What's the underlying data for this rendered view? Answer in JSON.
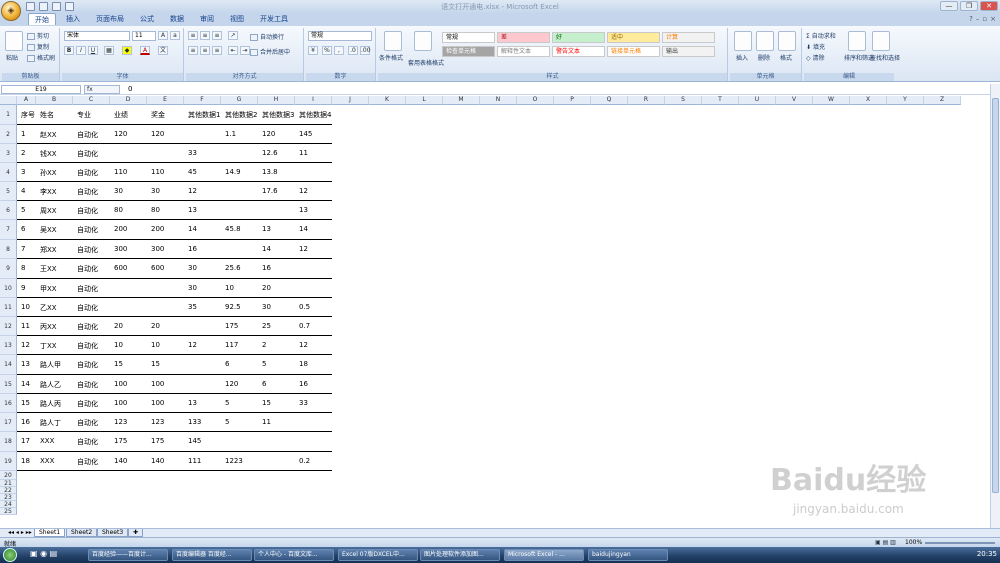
{
  "window": {
    "title": "语文打开通电.xlsx - Microsoft Excel",
    "min": "—",
    "max": "❐",
    "close": "✕"
  },
  "tabs": [
    "开始",
    "插入",
    "页面布局",
    "公式",
    "数据",
    "审阅",
    "视图",
    "开发工具"
  ],
  "ribbon": {
    "clipboard": {
      "label": "剪贴板",
      "paste": "粘贴",
      "cut": "剪切",
      "copy": "复制",
      "format_painter": "格式刷"
    },
    "font": {
      "label": "字体",
      "name": "宋体",
      "size": "11"
    },
    "alignment": {
      "label": "对齐方式",
      "wrap": "自动换行",
      "merge": "合并后居中"
    },
    "number": {
      "label": "数字",
      "format": "常规",
      "percent": "%",
      "comma": ","
    },
    "styles": {
      "label": "样式",
      "conditional": "条件格式",
      "table": "套用表格格式",
      "cells": [
        {
          "text": "常规",
          "bg": "#ffffff",
          "fg": "#000000"
        },
        {
          "text": "差",
          "bg": "#ffc7ce",
          "fg": "#9c0006"
        },
        {
          "text": "好",
          "bg": "#c6efce",
          "fg": "#006100"
        },
        {
          "text": "适中",
          "bg": "#ffeb9c",
          "fg": "#9c6500"
        },
        {
          "text": "计算",
          "bg": "#f2f2f2",
          "fg": "#fa7d00"
        },
        {
          "text": "检查单元格",
          "bg": "#a5a5a5",
          "fg": "#ffffff"
        },
        {
          "text": "解释性文本",
          "bg": "#ffffff",
          "fg": "#7f7f7f"
        },
        {
          "text": "警告文本",
          "bg": "#ffffff",
          "fg": "#ff0000"
        },
        {
          "text": "链接单元格",
          "bg": "#ffffff",
          "fg": "#fa7d00"
        },
        {
          "text": "输出",
          "bg": "#f2f2f2",
          "fg": "#3f3f3f"
        }
      ]
    },
    "cells_group": {
      "label": "单元格",
      "insert": "插入",
      "delete": "删除",
      "format": "格式"
    },
    "editing": {
      "label": "编辑",
      "autosum": "自动求和",
      "fill": "填充",
      "clear": "清除",
      "sort": "排序和筛选",
      "find": "查找和选择"
    }
  },
  "formula_bar": {
    "name_box": "E19",
    "fx": "fx",
    "value": "0"
  },
  "columns": [
    "A",
    "B",
    "C",
    "D",
    "E",
    "F",
    "G",
    "H",
    "I",
    "J",
    "K",
    "L",
    "M",
    "N",
    "O",
    "P",
    "Q",
    "R",
    "S",
    "T",
    "U",
    "V",
    "W",
    "X",
    "Y",
    "Z"
  ],
  "table": {
    "headers": [
      "序号",
      "姓名",
      "专业",
      "业绩",
      "奖金",
      "其他数据1",
      "其他数据2",
      "其他数据3",
      "其他数据4"
    ],
    "rows": [
      [
        "1",
        "赵XX",
        "自动化",
        "120",
        "120",
        "",
        "1.1",
        "120",
        "145"
      ],
      [
        "2",
        "钱XX",
        "自动化",
        "",
        "",
        "33",
        "",
        "12.6",
        "11"
      ],
      [
        "3",
        "孙XX",
        "自动化",
        "110",
        "110",
        "45",
        "14.9",
        "13.8",
        ""
      ],
      [
        "4",
        "李XX",
        "自动化",
        "30",
        "30",
        "12",
        "",
        "17.6",
        "12"
      ],
      [
        "5",
        "周XX",
        "自动化",
        "80",
        "80",
        "13",
        "",
        "",
        "13"
      ],
      [
        "6",
        "吴XX",
        "自动化",
        "200",
        "200",
        "14",
        "45.8",
        "13",
        "14"
      ],
      [
        "7",
        "郑XX",
        "自动化",
        "300",
        "300",
        "16",
        "",
        "14",
        "12"
      ],
      [
        "8",
        "王XX",
        "自动化",
        "600",
        "600",
        "30",
        "25.6",
        "16",
        ""
      ],
      [
        "9",
        "甲XX",
        "自动化",
        "",
        "",
        "30",
        "10",
        "20",
        ""
      ],
      [
        "10",
        "乙XX",
        "自动化",
        "",
        "",
        "35",
        "92.5",
        "30",
        "0.5"
      ],
      [
        "11",
        "丙XX",
        "自动化",
        "20",
        "20",
        "",
        "175",
        "25",
        "0.7"
      ],
      [
        "12",
        "丁XX",
        "自动化",
        "10",
        "10",
        "12",
        "117",
        "2",
        "12"
      ],
      [
        "13",
        "路人甲",
        "自动化",
        "15",
        "15",
        "",
        "6",
        "5",
        "18"
      ],
      [
        "14",
        "路人乙",
        "自动化",
        "100",
        "100",
        "",
        "120",
        "6",
        "16"
      ],
      [
        "15",
        "路人丙",
        "自动化",
        "100",
        "100",
        "13",
        "5",
        "15",
        "33"
      ],
      [
        "16",
        "路人丁",
        "自动化",
        "123",
        "123",
        "133",
        "5",
        "11",
        ""
      ],
      [
        "17",
        "XXX",
        "自动化",
        "175",
        "175",
        "145",
        "",
        "",
        ""
      ],
      [
        "18",
        "XXX",
        "自动化",
        "140",
        "140",
        "111",
        "1223",
        "",
        "0.2"
      ]
    ]
  },
  "row_numbers": [
    "1",
    "2",
    "3",
    "4",
    "5",
    "6",
    "7",
    "8",
    "9",
    "10",
    "11",
    "12",
    "13",
    "14",
    "15",
    "16",
    "17",
    "18",
    "19",
    "20",
    "21",
    "22",
    "23",
    "24",
    "25"
  ],
  "sheets": [
    "Sheet1",
    "Sheet2",
    "Sheet3"
  ],
  "status": {
    "ready": "就绪",
    "zoom": "100%"
  },
  "taskbar": {
    "items": [
      "百度经验——百度计...",
      "百度编辑器 百度经...",
      "个人中心 - 百度文库...",
      "Excel 07版DXCEL中...",
      "图片处理软件添加图...",
      "Microsoft Excel - ...",
      "baidujingyan"
    ],
    "time": "20:35"
  },
  "watermark": {
    "text": "Baidu经验",
    "sub": "jingyan.baidu.com"
  }
}
